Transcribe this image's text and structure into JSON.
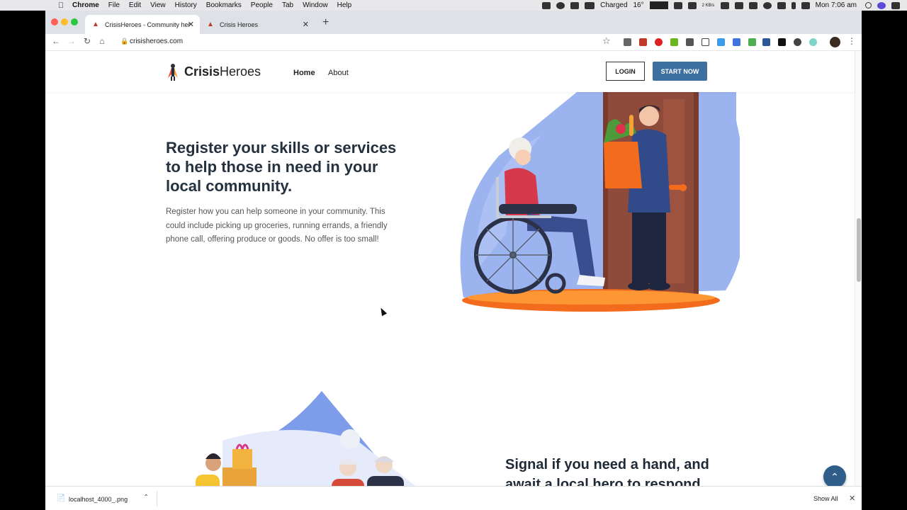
{
  "menubar": {
    "app": "Chrome",
    "items": [
      "File",
      "Edit",
      "View",
      "History",
      "Bookmarks",
      "People",
      "Tab",
      "Window",
      "Help"
    ],
    "battery": "Charged",
    "temperature": "16°",
    "network": "2 KB/s",
    "clock": "Mon 7:06 am"
  },
  "browser": {
    "tabs": [
      {
        "title": "CrisisHeroes - Community heroes"
      },
      {
        "title": "Crisis Heroes"
      }
    ],
    "new_tab": "+",
    "url": "crisisheroes.com"
  },
  "site": {
    "logo_bold": "Crisis",
    "logo_light": "Heroes",
    "nav": {
      "home": "Home",
      "about": "About"
    },
    "login": "LOGIN",
    "start": "START NOW"
  },
  "hero": {
    "title": "Register your skills or services to help those in need in your local community.",
    "body": "Register how you can help someone in your community. This could include picking up groceries, running errands, a friendly phone call, offering produce or goods. No offer is too small!"
  },
  "section2": {
    "title": "Signal if you need a hand, and await a local hero to respond"
  },
  "downloads": {
    "file": "localhost_4000_.png",
    "show_all": "Show All"
  },
  "colors": {
    "brand_blue": "#3d6fa1",
    "heading": "#243240",
    "illus_blue": "#8aa6ec",
    "illus_orange": "#f36b1c"
  }
}
